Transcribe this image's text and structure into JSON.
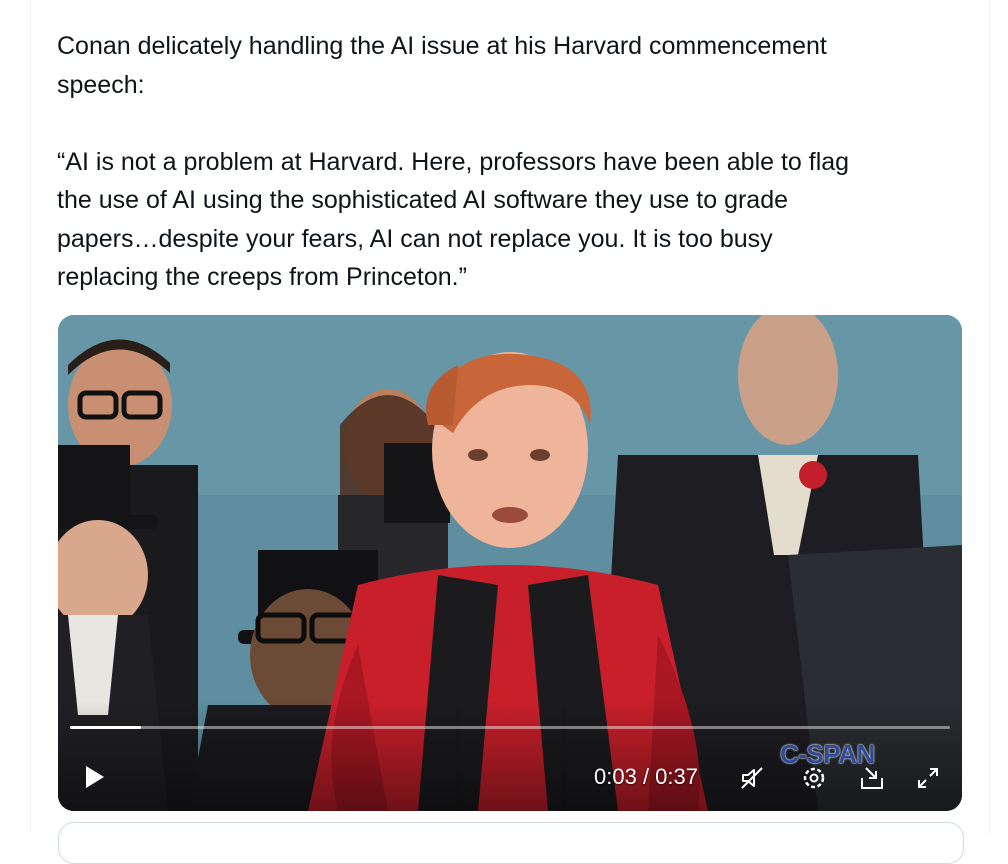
{
  "post": {
    "text": "Conan delicately handling the AI issue at his Harvard commencement\nspeech:\n\n“AI is not a problem at Harvard. Here, professors have been able to flag\nthe use of AI using the sophisticated AI software they use to grade\npapers…despite your fears, AI can not replace you. It is too busy\nreplacing the creeps from Princeton.”"
  },
  "video": {
    "current_time": "0:03",
    "separator": " / ",
    "duration": "0:37",
    "time_display": "0:03 / 0:37",
    "progress": 0.081,
    "watermark": "C-SPAN",
    "icons": [
      "play-icon",
      "muted-speaker-icon",
      "settings-gear-icon",
      "dock-video-icon",
      "fullscreen-icon"
    ]
  },
  "colors": {
    "text": "#0f1419",
    "watermark": "#2f4a96",
    "robe_red": "#c81f2a"
  }
}
